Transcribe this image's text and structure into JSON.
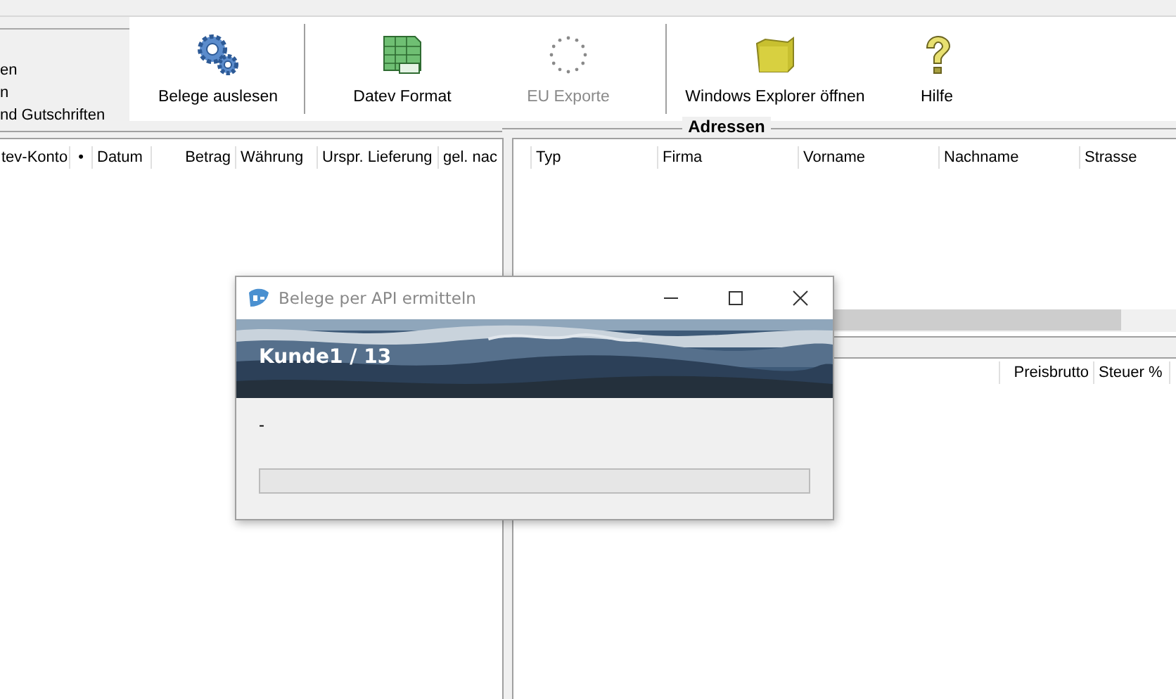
{
  "left_panel": {
    "items": [
      "en",
      "n",
      "nd Gutschriften"
    ]
  },
  "toolbar": [
    {
      "kind": "button",
      "label": "Belege auslesen",
      "disabled": false
    },
    {
      "kind": "separator"
    },
    {
      "kind": "button",
      "label": "Datev Format",
      "disabled": false
    },
    {
      "kind": "button",
      "label": "EU Exporte",
      "disabled": true
    },
    {
      "kind": "separator"
    },
    {
      "kind": "button",
      "label": "Windows Explorer öffnen",
      "disabled": false
    },
    {
      "kind": "button",
      "label": "Hilfe",
      "disabled": false
    }
  ],
  "left_table": {
    "columns": [
      "tev-Konto",
      "•",
      "Datum",
      "Betrag",
      "Währung",
      "Urspr. Lieferung",
      "gel. nac"
    ]
  },
  "addresses": {
    "title": "Adressen",
    "columns": [
      "Typ",
      "Firma",
      "Vorname",
      "Nachname",
      "Strasse"
    ]
  },
  "lower_table": {
    "columns": [
      "Preisbrutto",
      "Steuer %"
    ]
  },
  "dialog": {
    "title": "Belege per API ermitteln",
    "heading": "Kunde1 / 13",
    "status": "-",
    "progress": {
      "level": 0
    }
  }
}
